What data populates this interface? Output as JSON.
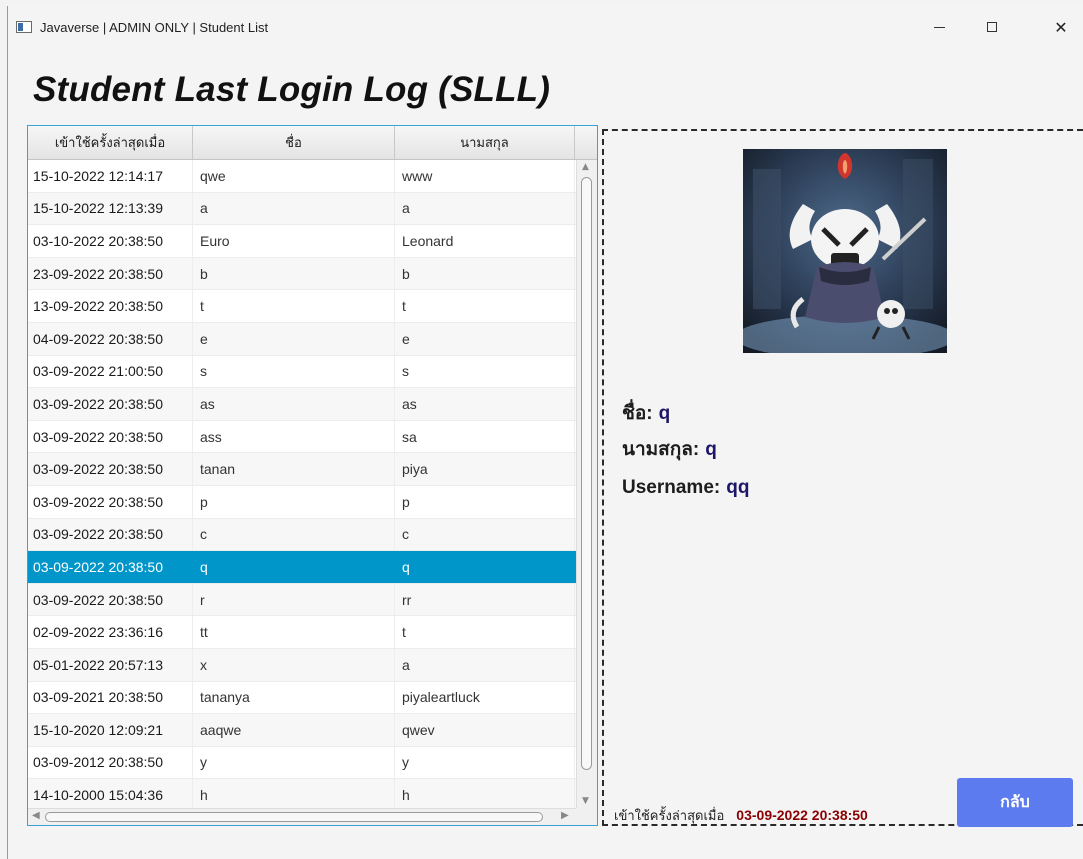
{
  "window": {
    "title": "Javaverse | ADMIN ONLY | Student List",
    "minimize_glyph": "—",
    "maximize_glyph": "☐",
    "close_glyph": "✕"
  },
  "page_title": "Student Last Login Log (SLLL)",
  "table": {
    "columns": [
      "เข้าใช้ครั้งล่าสุดเมื่อ",
      "ชื่อ",
      "นามสกุล"
    ],
    "selected_index": 12,
    "rows": [
      [
        "15-10-2022 12:14:17",
        "qwe",
        "www"
      ],
      [
        "15-10-2022 12:13:39",
        "a",
        "a"
      ],
      [
        "03-10-2022 20:38:50",
        "Euro",
        "Leonard"
      ],
      [
        "23-09-2022 20:38:50",
        "b",
        "b"
      ],
      [
        "13-09-2022 20:38:50",
        "t",
        "t"
      ],
      [
        "04-09-2022 20:38:50",
        "e",
        "e"
      ],
      [
        "03-09-2022 21:00:50",
        "s",
        "s"
      ],
      [
        "03-09-2022 20:38:50",
        "as",
        "as"
      ],
      [
        "03-09-2022 20:38:50",
        "ass",
        "sa"
      ],
      [
        "03-09-2022 20:38:50",
        "tanan",
        "piya"
      ],
      [
        "03-09-2022 20:38:50",
        "p",
        "p"
      ],
      [
        "03-09-2022 20:38:50",
        "c",
        "c"
      ],
      [
        "03-09-2022 20:38:50",
        "q",
        "q"
      ],
      [
        "03-09-2022 20:38:50",
        "r",
        "rr"
      ],
      [
        "02-09-2022 23:36:16",
        "tt",
        "t"
      ],
      [
        "05-01-2022 20:57:13",
        "x",
        "a"
      ],
      [
        "03-09-2021 20:38:50",
        "tananya",
        "piyaleartluck"
      ],
      [
        "15-10-2020 12:09:21",
        "aaqwe",
        "qwev"
      ],
      [
        "03-09-2012 20:38:50",
        "y",
        "y"
      ],
      [
        "14-10-2000 15:04:36",
        "h",
        "h"
      ]
    ]
  },
  "details": {
    "avatar_icon": "hollow-knight-character-avatar",
    "name_label": "ชื่อ:",
    "name_value": "q",
    "surname_label": "นามสกุล:",
    "surname_value": "q",
    "username_label": "Username:",
    "username_value": "qq",
    "last_login_label": "เข้าใช้ครั้งล่าสุดเมื่อ",
    "last_login_value": "03-09-2022 20:38:50"
  },
  "back_button": "กลับ",
  "colors": {
    "selection": "#0096c9",
    "accent_button": "#5b7bef",
    "detail_value": "#1e1669",
    "last_login_value": "#8b0000"
  }
}
